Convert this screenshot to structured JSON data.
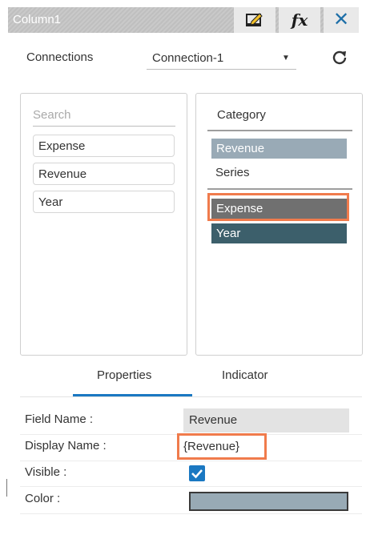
{
  "titlebar": {
    "title": "Column1",
    "icons": [
      "edit-chart-icon",
      "fx-icon",
      "close-icon"
    ],
    "fx_label": "fx",
    "close_label": "✕"
  },
  "connections": {
    "label": "Connections",
    "selected": "Connection-1",
    "refresh_icon": "refresh-icon"
  },
  "fields_panel": {
    "search_placeholder": "Search",
    "items": [
      "Expense",
      "Revenue",
      "Year"
    ]
  },
  "category_panel": {
    "category_heading": "Category",
    "category_items": [
      "Revenue"
    ],
    "series_heading": "Series",
    "series_items": [
      "Expense",
      "Year"
    ],
    "highlighted_series": "Expense"
  },
  "tabs": [
    {
      "label": "Properties",
      "active": true
    },
    {
      "label": "Indicator",
      "active": false
    }
  ],
  "properties": {
    "field_name_label": "Field Name :",
    "field_name_value": "Revenue",
    "display_name_label": "Display Name :",
    "display_name_value": "{Revenue}",
    "visible_label": "Visible :",
    "visible_checked": true,
    "color_label": "Color :",
    "color_value": "#98aab5"
  },
  "colors": {
    "accent": "#1a78c2",
    "highlight": "#f07b4c",
    "chip_revenue": "#99aab6",
    "chip_expense": "#707070",
    "chip_year": "#3c5f6b"
  }
}
